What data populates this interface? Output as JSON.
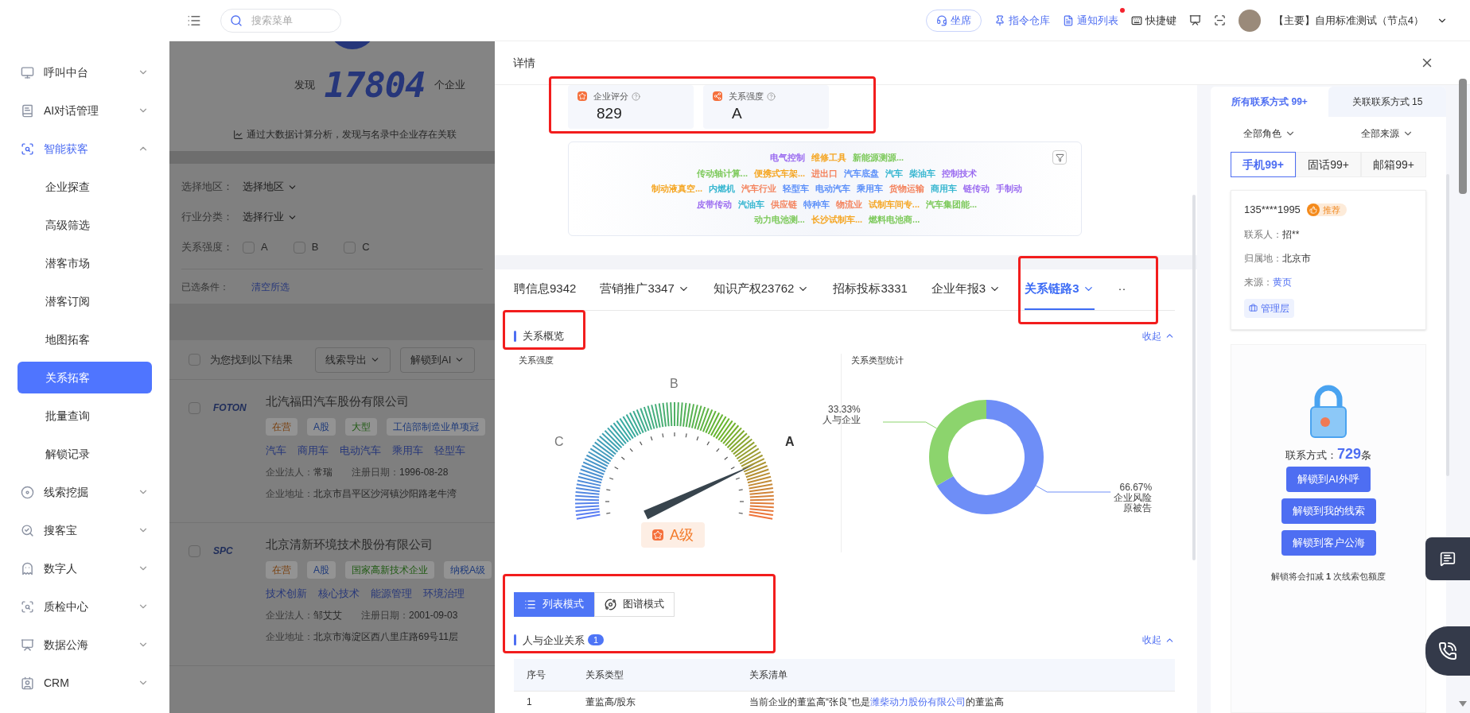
{
  "sidebar": {
    "items": [
      {
        "label": "呼叫中台",
        "selected": false,
        "expanded": false
      },
      {
        "label": "AI对话管理",
        "selected": false,
        "expanded": false
      },
      {
        "label": "智能获客",
        "selected": true,
        "expanded": true,
        "children": [
          {
            "label": "企业探查",
            "selected": false
          },
          {
            "label": "高级筛选",
            "selected": false
          },
          {
            "label": "潜客市场",
            "selected": false
          },
          {
            "label": "潜客订阅",
            "selected": false
          },
          {
            "label": "地图拓客",
            "selected": false
          },
          {
            "label": "关系拓客",
            "selected": true
          },
          {
            "label": "批量查询",
            "selected": false
          },
          {
            "label": "解锁记录",
            "selected": false
          }
        ]
      },
      {
        "label": "线索挖掘",
        "selected": false,
        "expanded": false
      },
      {
        "label": "搜客宝",
        "selected": false,
        "expanded": false
      },
      {
        "label": "数字人",
        "selected": false,
        "expanded": false
      },
      {
        "label": "质检中心",
        "selected": false,
        "expanded": false
      },
      {
        "label": "数据公海",
        "selected": false,
        "expanded": false
      },
      {
        "label": "CRM",
        "selected": false,
        "expanded": false
      }
    ]
  },
  "topbar": {
    "search": {
      "placeholder": "搜索菜单"
    },
    "actions": [
      {
        "label": "坐席",
        "kind": "pill",
        "dot": false
      },
      {
        "label": "指令仓库",
        "kind": "link",
        "dot": false
      },
      {
        "label": "通知列表",
        "kind": "link",
        "dot": true
      },
      {
        "label": "快捷键",
        "kind": "plain",
        "dot": false
      }
    ],
    "user": "【主要】自用标准测试（节点4）"
  },
  "background": {
    "banner": {
      "prefix": "发现",
      "count": "17804",
      "suffix": "个企业",
      "note": "通过大数据计算分析，发现与名录中企业存在关联"
    },
    "filters": [
      {
        "label": "选择地区：",
        "kind": "select",
        "value": "选择地区"
      },
      {
        "label": "行业分类：",
        "kind": "select",
        "value": "选择行业"
      },
      {
        "label": "关系强度：",
        "kind": "checks",
        "options": [
          {
            "label": "A",
            "checked": false
          },
          {
            "label": "B",
            "checked": false
          },
          {
            "label": "C",
            "checked": false
          }
        ]
      }
    ],
    "conditions": {
      "label": "已选条件：",
      "action": "清空所选"
    },
    "results": {
      "label": "为您找到以下结果",
      "checked": false,
      "buttons": [
        "线索导出",
        "解锁到AI"
      ]
    },
    "companies": [
      {
        "name": "北汽福田汽车股份有限公司",
        "logo": "FOTON",
        "checked": false,
        "tags": [
          {
            "text": "在营",
            "color": "#7a3f0c"
          },
          {
            "text": "A股",
            "color": "#1e3a7a"
          },
          {
            "text": "大型",
            "color": "#1f5a12"
          },
          {
            "text": "工信部制造业单项冠",
            "color": "#1e3a7a"
          }
        ],
        "keywords": [
          "汽车",
          "商用车",
          "电动汽车",
          "乘用车",
          "轻型车"
        ],
        "legal_label": "企业法人：",
        "legal": "常瑞",
        "date_label": "注册日期：",
        "date": "1996-08-28",
        "address_label": "企业地址：",
        "address": "北京市昌平区沙河镇沙阳路老牛湾"
      },
      {
        "name": "北京清新环境技术股份有限公司",
        "logo": "SPC",
        "checked": false,
        "tags": [
          {
            "text": "在营",
            "color": "#7a3f0c"
          },
          {
            "text": "A股",
            "color": "#1e3a7a"
          },
          {
            "text": "国家高新技术企业",
            "color": "#1f5a12"
          },
          {
            "text": "纳税A级",
            "color": "#1e3a7a"
          }
        ],
        "keywords": [
          "技术创新",
          "核心技术",
          "能源管理",
          "环境治理"
        ],
        "legal_label": "企业法人：",
        "legal": "邹艾艾",
        "date_label": "注册日期：",
        "date": "2001-09-03",
        "address_label": "企业地址：",
        "address": "北京市海淀区西八里庄路69号11层"
      }
    ]
  },
  "drawer": {
    "title": "详情",
    "metrics": [
      {
        "label": "企业评分",
        "value": "829"
      },
      {
        "label": "关系强度",
        "value": "A"
      }
    ],
    "word_cloud": {
      "rows": [
        [
          {
            "text": "电气控制",
            "color": "#9b6cf0"
          },
          {
            "text": "维修工具",
            "color": "#f5a623"
          },
          {
            "text": "新能源测源...",
            "color": "#7cc95a"
          }
        ],
        [
          {
            "text": "传动轴计算...",
            "color": "#7cc95a"
          },
          {
            "text": "便携式车架...",
            "color": "#f5a623"
          },
          {
            "text": "进出口",
            "color": "#f4845f"
          },
          {
            "text": "汽车底盘",
            "color": "#5b8ff9"
          },
          {
            "text": "汽车",
            "color": "#36b6d0"
          },
          {
            "text": "柴油车",
            "color": "#36b6d0"
          },
          {
            "text": "控制技术",
            "color": "#9b6cf0"
          }
        ],
        [
          {
            "text": "制动液真空...",
            "color": "#f5a623"
          },
          {
            "text": "内燃机",
            "color": "#36b6d0"
          },
          {
            "text": "汽车行业",
            "color": "#f4845f"
          },
          {
            "text": "轻型车",
            "color": "#5b8ff9"
          },
          {
            "text": "电动汽车",
            "color": "#5b8ff9"
          },
          {
            "text": "乘用车",
            "color": "#5b8ff9"
          },
          {
            "text": "货物运输",
            "color": "#f4845f"
          },
          {
            "text": "商用车",
            "color": "#36b6d0"
          },
          {
            "text": "链传动",
            "color": "#9b6cf0"
          },
          {
            "text": "手制动",
            "color": "#9b6cf0"
          }
        ],
        [
          {
            "text": "皮带传动",
            "color": "#9b6cf0"
          },
          {
            "text": "汽油车",
            "color": "#36b6d0"
          },
          {
            "text": "供应链",
            "color": "#f4845f"
          },
          {
            "text": "特种车",
            "color": "#5b8ff9"
          },
          {
            "text": "物流业",
            "color": "#f4845f"
          },
          {
            "text": "试制车间专...",
            "color": "#f5a623"
          },
          {
            "text": "汽车集团能...",
            "color": "#7cc95a"
          }
        ],
        [
          {
            "text": "动力电池测...",
            "color": "#7cc95a"
          },
          {
            "text": "长沙试制车...",
            "color": "#f5a623"
          },
          {
            "text": "燃料电池商...",
            "color": "#7cc95a"
          }
        ]
      ]
    },
    "tabs": [
      {
        "label": "聘信息9342",
        "dropdown": false,
        "selected": false
      },
      {
        "label": "营销推广3347",
        "dropdown": true,
        "selected": false
      },
      {
        "label": "知识产权23762",
        "dropdown": true,
        "selected": false
      },
      {
        "label": "招标投标3331",
        "dropdown": false,
        "selected": false
      },
      {
        "label": "企业年报3",
        "dropdown": true,
        "selected": false
      },
      {
        "label": "关系链路3",
        "dropdown": true,
        "selected": true
      },
      {
        "label": "··",
        "dropdown": false,
        "selected": false
      }
    ],
    "overview": {
      "title": "关系概览",
      "collapse": "收起",
      "gauge": {
        "title": "关系强度",
        "labels": [
          {
            "text": "C",
            "selected": false
          },
          {
            "text": "B",
            "selected": false
          },
          {
            "text": "A",
            "selected": true
          }
        ],
        "grade": "A级"
      },
      "stats": {
        "title": "关系类型统计",
        "chart_data": {
          "type": "donut",
          "categories": [
            "企业风险原被告",
            "人与企业"
          ],
          "values": [
            66.67,
            33.33
          ],
          "colors": [
            "#6e8ef7",
            "#8cd46d"
          ],
          "data_labels": true,
          "value_labels": [
            "66.67%",
            "33.33%"
          ]
        }
      }
    },
    "modes": [
      {
        "label": "列表模式",
        "selected": true
      },
      {
        "label": "图谱模式",
        "selected": false
      }
    ],
    "relations": {
      "title": "人与企业关系",
      "count": "1",
      "collapse": "收起",
      "columns": [
        "序号",
        "关系类型",
        "关系清单"
      ],
      "rows": [
        {
          "index": "1",
          "type": "董监高/股东",
          "before": "当前企业的董监高“张良”也是",
          "link": "潍柴动力股份有限公司",
          "after": "的董监高"
        }
      ]
    }
  },
  "contacts": {
    "tabs": [
      {
        "label": "所有联系方式 99+",
        "selected": true
      },
      {
        "label": "关联联系方式 15",
        "selected": false
      }
    ],
    "filters": [
      "全部角色",
      "全部来源"
    ],
    "types": [
      {
        "label": "手机99+",
        "selected": true
      },
      {
        "label": "固话99+",
        "selected": false
      },
      {
        "label": "邮箱99+",
        "selected": false
      }
    ],
    "card": {
      "phone": "135****1995",
      "badge": "推荐",
      "fields": [
        {
          "label": "联系人：",
          "value": "招**",
          "kind": "text"
        },
        {
          "label": "归属地：",
          "value": "北京市",
          "kind": "text"
        },
        {
          "label": "来源：",
          "value": "黄页",
          "kind": "link"
        }
      ],
      "tag": "管理层"
    },
    "locked": {
      "label": "联系方式：",
      "count": "729",
      "unit": "条",
      "buttons": [
        "解锁到AI外呼",
        "解锁到我的线索",
        "解锁到客户公海"
      ],
      "note": "解锁将会扣减 **1** 次线索包额度"
    }
  }
}
